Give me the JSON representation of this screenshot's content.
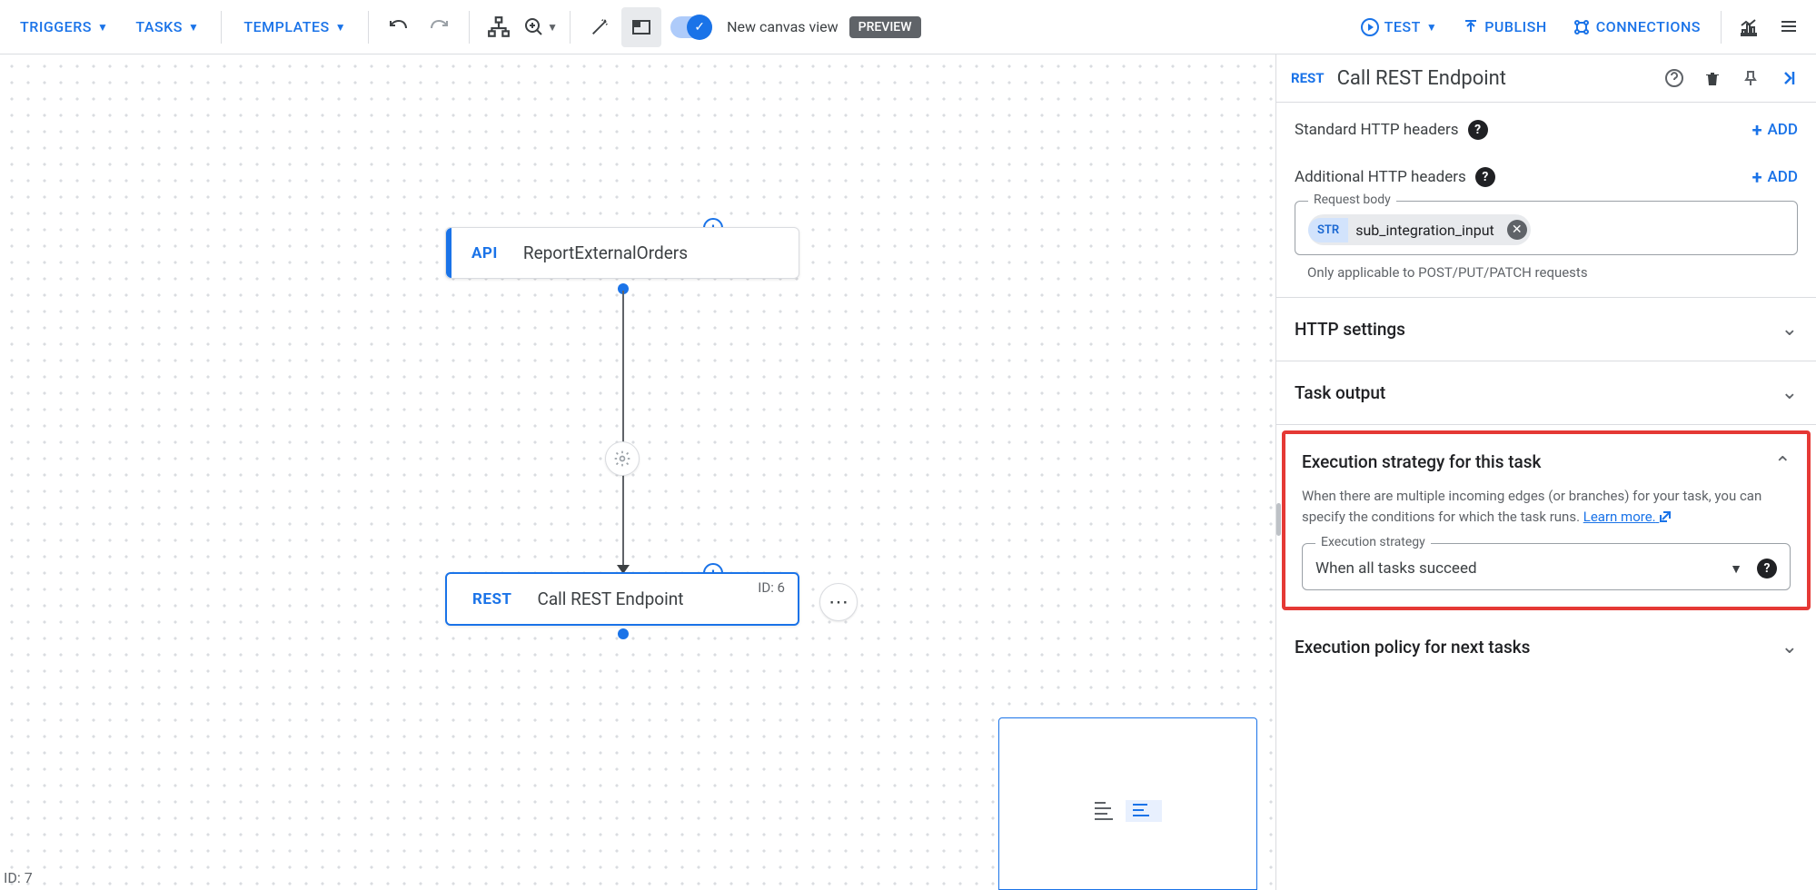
{
  "toolbar": {
    "triggers": "TRIGGERS",
    "tasks": "TASKS",
    "templates": "TEMPLATES",
    "newCanvas": "New canvas view",
    "preview": "PREVIEW",
    "test": "TEST",
    "publish": "PUBLISH",
    "connections": "CONNECTIONS"
  },
  "canvas": {
    "trigger": {
      "badge": "API",
      "title": "ReportExternalOrders"
    },
    "task": {
      "badge": "REST",
      "title": "Call REST Endpoint",
      "id": "ID: 6"
    },
    "cornerId": "ID: 7"
  },
  "panel": {
    "headerBadge": "REST",
    "title": "Call REST Endpoint",
    "stdHeaders": "Standard HTTP headers",
    "addlHeaders": "Additional HTTP headers",
    "add": "ADD",
    "requestBody": {
      "legend": "Request body",
      "chipType": "STR",
      "chipValue": "sub_integration_input"
    },
    "requestHint": "Only applicable to POST/PUT/PATCH requests",
    "httpSettings": "HTTP settings",
    "taskOutput": "Task output",
    "execStrategy": {
      "title": "Execution strategy for this task",
      "desc1": "When there are multiple incoming edges (or branches) for your task, you can specify the conditions for which the task runs. ",
      "learnMore": "Learn more.",
      "selectLegend": "Execution strategy",
      "selectValue": "When all tasks succeed"
    },
    "execPolicy": "Execution policy for next tasks"
  }
}
